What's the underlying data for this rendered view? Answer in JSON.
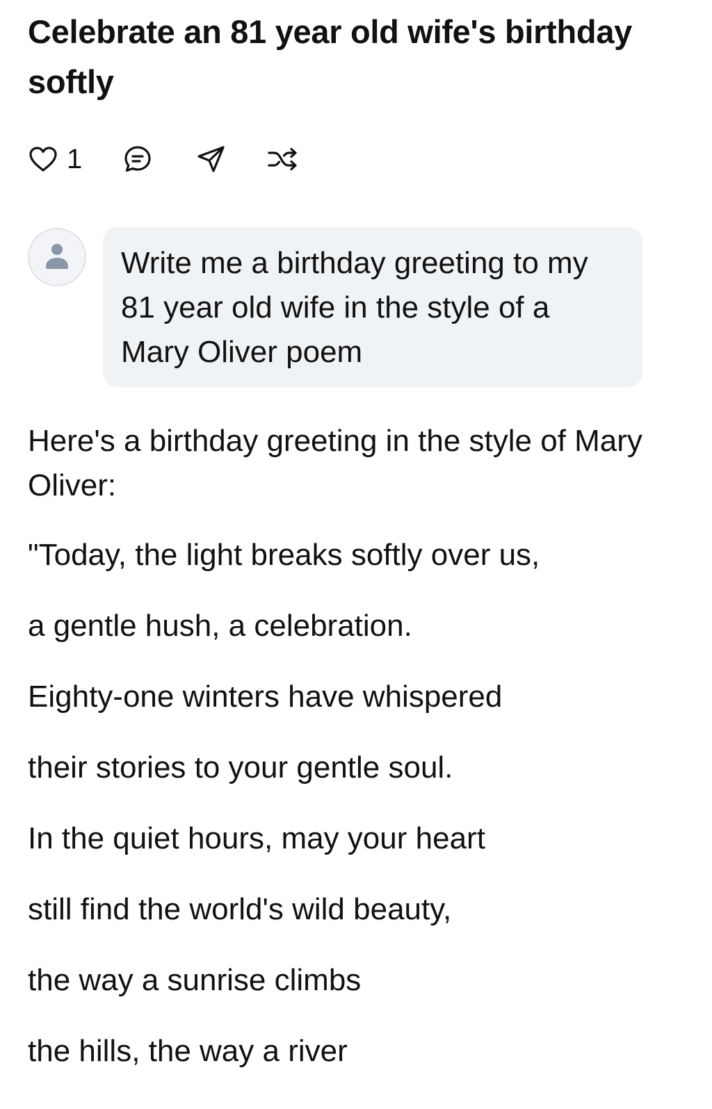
{
  "chat": {
    "title": "Celebrate an 81 year old wife's birthday softly",
    "like_count": "1"
  },
  "icons": {
    "like": "heart-icon",
    "comment": "comment-icon",
    "share": "send-icon",
    "remix": "shuffle-icon",
    "avatar": "user-icon"
  },
  "colors": {
    "text": "#111111",
    "bubble_background": "#f0f3f6",
    "avatar_background": "#f2f4f7",
    "avatar_icon": "#8a97a8"
  },
  "user_message": {
    "text": "Write me a birthday greeting to my 81 year old wife in the style of a Mary Oliver poem"
  },
  "response": {
    "intro": "Here's a birthday greeting in the style of Mary Oliver:",
    "lines": [
      "\"Today, the light breaks softly over us,",
      "a gentle hush, a celebration.",
      "Eighty-one winters have whispered",
      "their stories to your gentle soul.",
      "In the quiet hours, may your heart",
      "still find the world's wild beauty,",
      "the way a sunrise climbs",
      "the hills, the way a river"
    ]
  }
}
